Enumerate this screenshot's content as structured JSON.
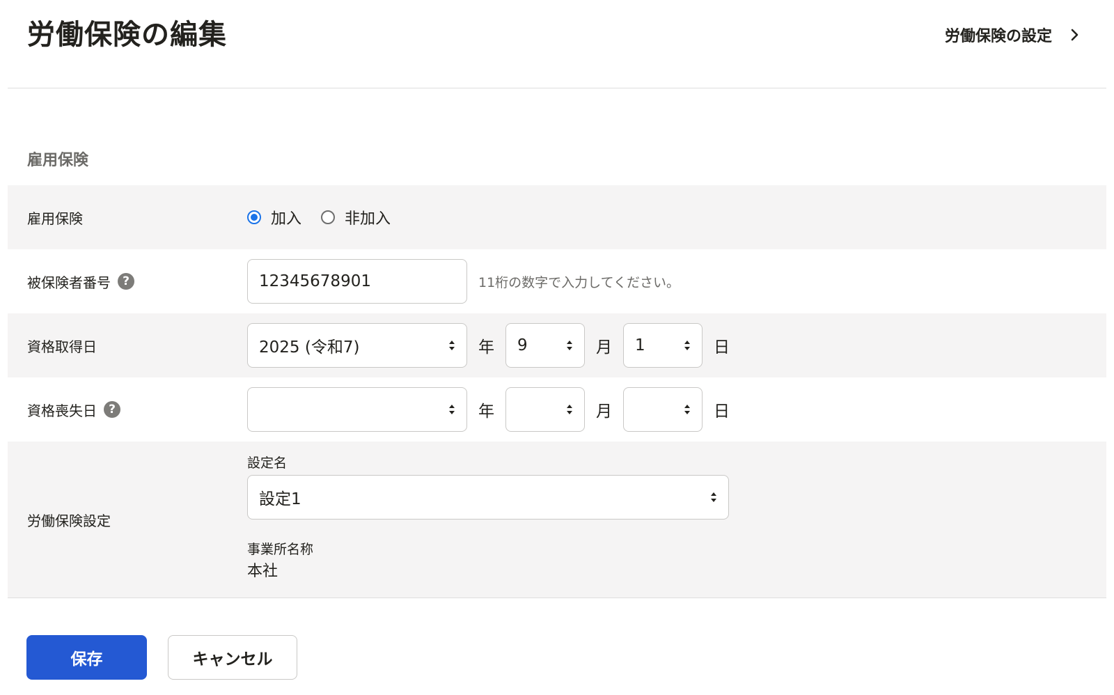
{
  "header": {
    "title": "労働保険の編集",
    "settings_link": "労働保険の設定",
    "settings_icon": "chevron-right-icon"
  },
  "section": {
    "title": "雇用保険"
  },
  "form": {
    "employment_insurance": {
      "label": "雇用保険",
      "options": [
        "加入",
        "非加入"
      ],
      "selected": "加入"
    },
    "insured_number": {
      "label": "被保険者番号",
      "value": "12345678901",
      "hint": "11桁の数字で入力してください。",
      "help_icon": "?"
    },
    "acquisition_date": {
      "label": "資格取得日",
      "year": "2025 (令和7)",
      "month": "9",
      "day": "1",
      "unit_year": "年",
      "unit_month": "月",
      "unit_day": "日"
    },
    "loss_date": {
      "label": "資格喪失日",
      "year": "",
      "month": "",
      "day": "",
      "unit_year": "年",
      "unit_month": "月",
      "unit_day": "日",
      "help_icon": "?"
    },
    "labor_insurance_setting": {
      "label": "労働保険設定",
      "setting_name_label": "設定名",
      "setting_name_value": "設定1",
      "office_name_label": "事業所名称",
      "office_name_value": "本社"
    }
  },
  "actions": {
    "save": "保存",
    "cancel": "キャンセル"
  },
  "colors": {
    "primary": "#2459d3",
    "radio_checked": "#1a73e8",
    "row_shade": "#f5f4f4"
  }
}
